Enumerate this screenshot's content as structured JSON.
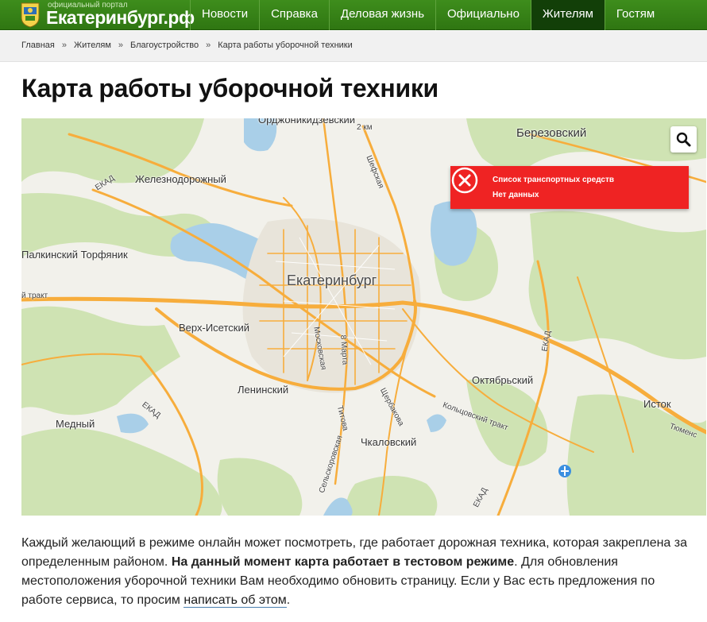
{
  "header": {
    "portal_small": "официальный портал",
    "portal_title": "Екатеринбург.рф",
    "nav": [
      {
        "label": "Новости",
        "active": false
      },
      {
        "label": "Справка",
        "active": false
      },
      {
        "label": "Деловая жизнь",
        "active": false
      },
      {
        "label": "Официально",
        "active": false
      },
      {
        "label": "Жителям",
        "active": true
      },
      {
        "label": "Гостям",
        "active": false
      }
    ]
  },
  "breadcrumb": {
    "items": [
      "Главная",
      "Жителям",
      "Благоустройство",
      "Карта работы уборочной техники"
    ],
    "separator": "»"
  },
  "page": {
    "title": "Карта работы уборочной техники"
  },
  "map": {
    "labels": {
      "ordzh": "Орджоникидзевский",
      "km": "2 км",
      "berez": "Березовский",
      "zhel": "Железнодорожный",
      "ekad1": "ЕКАД",
      "sherskaya": "Шефская",
      "palkin": "Палкинский Торфяник",
      "ekb": "Екатеринбург",
      "trakt": "й тракт",
      "verkh": "Верх-Исетский",
      "moskov": "Московская",
      "vos": "8 Марта",
      "ekad2": "ЕКАД",
      "oktyab": "Октябрьский",
      "lenin": "Ленинский",
      "sherb": "Щербакова",
      "tito": "Титова",
      "kolts": "Кольцовский тракт",
      "istok": "Исток",
      "medny": "Медный",
      "ekad3": "ЕКАД",
      "chkal": "Чкаловский",
      "selko": "Сельскоровская",
      "ekad4": "ЕКАД",
      "tyumen": "Тюменс"
    },
    "alert": {
      "title": "Список транспортных средств",
      "text": "Нет данных"
    },
    "colors": {
      "forest": "#cfe3b3",
      "water": "#a9cfe8",
      "road": "#f7ad3c",
      "alert": "#ef2323"
    }
  },
  "description": {
    "part1": "Каждый желающий в режиме онлайн может посмотреть, где работает дорожная техника, которая закреплена за определенным районом.",
    "bold": "На данный момент карта работает в тестовом режиме",
    "part2": ". Для обновления местоположения уборочной техники Вам необходимо обновить страницу. Если у Вас есть предложения по работе сервиса, то просим",
    "link": "написать об этом",
    "end": "."
  }
}
